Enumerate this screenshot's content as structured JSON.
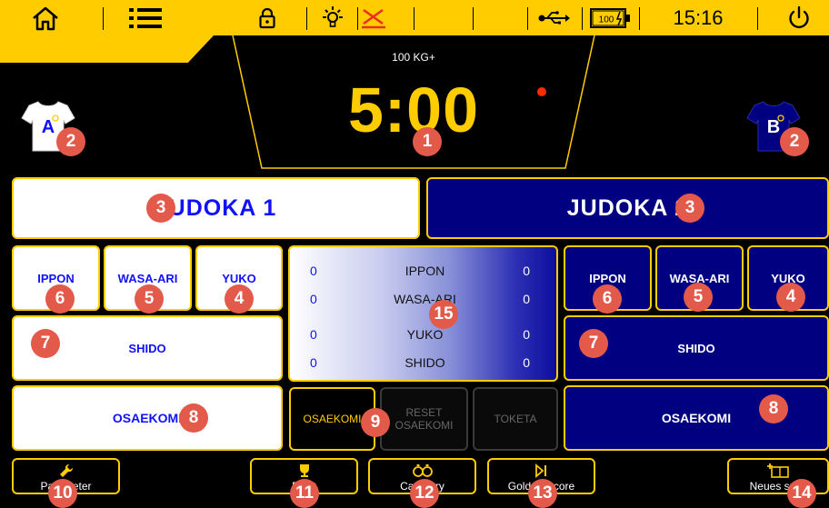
{
  "header": {
    "clock": "15:16",
    "battery_text": "100"
  },
  "timer": {
    "weight_class": "100 KG+",
    "time": "5:00"
  },
  "judoka_white": {
    "name": "JUDOKA 1",
    "shirt_letter": "A",
    "ippon": "IPPON",
    "wasa_ari": "WASA-ARI",
    "yuko": "YUKO",
    "shido": "SHIDO",
    "osaekomi": "OSAEKOMI"
  },
  "judoka_blue": {
    "name": "JUDOKA 2",
    "shirt_letter": "B",
    "ippon": "IPPON",
    "wasa_ari": "WASA-ARI",
    "yuko": "YUKO",
    "shido": "SHIDO",
    "osaekomi": "OSAEKOMI"
  },
  "scoreboard": [
    {
      "label": "IPPON",
      "white": "0",
      "blue": "0"
    },
    {
      "label": "WASA-ARI",
      "white": "0",
      "blue": "0"
    },
    {
      "label": "YUKO",
      "white": "0",
      "blue": "0"
    },
    {
      "label": "SHIDO",
      "white": "0",
      "blue": "0"
    }
  ],
  "center_controls": {
    "osaekomi": "OSAEKOMI",
    "reset_osaekomi": "RESET OSAEKOMI",
    "toketa": "TOKETA"
  },
  "bottom_bar": {
    "parameter": "Parameter",
    "fight": "Fight",
    "category": "Category",
    "golden_score": "Golden Score",
    "new_fight": "Neues spiel"
  },
  "callouts": [
    "1",
    "2",
    "2",
    "3",
    "3",
    "4",
    "4",
    "5",
    "5",
    "6",
    "6",
    "7",
    "7",
    "8",
    "8",
    "9",
    "10",
    "11",
    "12",
    "13",
    "14",
    "15"
  ],
  "colors": {
    "accent": "#FFCC00",
    "blue_judoka": "#000080",
    "white_judoka": "#FFFFFF",
    "callout": "#E35A4A",
    "record": "#FF2A00"
  },
  "icons": {
    "home": "home-icon",
    "menu": "list-menu-icon",
    "lock": "lock-icon",
    "brightness": "sun-icon",
    "sound": "muted-icon",
    "usb": "usb-icon",
    "battery": "battery-icon",
    "power": "power-icon"
  }
}
